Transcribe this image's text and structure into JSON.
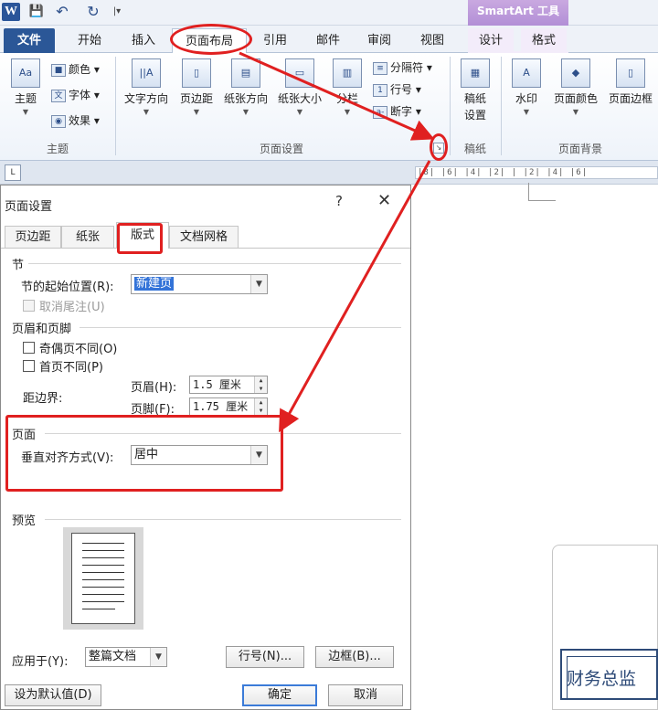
{
  "quick_access": {
    "app_logo": "W",
    "save_icon": "💾",
    "undo_icon": "↶",
    "redo_icon": "↻",
    "more_icon": "|▾"
  },
  "smartart_context_title": "SmartArt 工具",
  "ribbon_tabs": {
    "file": "文件",
    "home": "开始",
    "insert": "插入",
    "page_layout": "页面布局",
    "references": "引用",
    "mailings": "邮件",
    "review": "审阅",
    "view": "视图",
    "design": "设计",
    "format": "格式"
  },
  "ribbon": {
    "themes_group": {
      "label": "主题",
      "themes_btn": "主题",
      "colors_btn": "颜色",
      "fonts_btn": "字体",
      "effects_btn": "效果"
    },
    "page_setup_group": {
      "label": "页面设置",
      "text_direction": "文字方向",
      "margins": "页边距",
      "orientation": "纸张方向",
      "size": "纸张大小",
      "columns": "分栏",
      "breaks": "分隔符",
      "line_numbers": "行号",
      "hyphenation": "断字"
    },
    "draft_group": {
      "label": "稿纸",
      "draft_settings_line1": "稿纸",
      "draft_settings_line2": "设置"
    },
    "background_group": {
      "label": "页面背景",
      "watermark": "水印",
      "page_color": "页面颜色",
      "page_borders": "页面边框"
    },
    "launcher_icon": "↘"
  },
  "ruler": {
    "tab_selector": "L",
    "marks": "|8| |6| |4| |2| |  |2| |4| |6|"
  },
  "dialog": {
    "title": "页面设置",
    "help": "?",
    "close": "✕",
    "tabs": {
      "margins": "页边距",
      "paper": "纸张",
      "layout": "版式",
      "doc_grid": "文档网格"
    },
    "section": {
      "title": "节",
      "start_label": "节的起始位置(R):",
      "start_value": "新建页",
      "suppress_endnotes": "取消尾注(U)"
    },
    "headers_footers": {
      "title": "页眉和页脚",
      "odd_even": "奇偶页不同(O)",
      "first_page": "首页不同(P)",
      "from_edge_label": "距边界:",
      "header_label": "页眉(H):",
      "header_value": "1.5 厘米",
      "footer_label": "页脚(F):",
      "footer_value": "1.75 厘米"
    },
    "page": {
      "title": "页面",
      "vertical_align_label": "垂直对齐方式(V):",
      "vertical_align_value": "居中"
    },
    "preview": {
      "title": "预览",
      "apply_to_label": "应用于(Y):",
      "apply_to_value": "整篇文档",
      "line_numbers_btn": "行号(N)...",
      "borders_btn": "边框(B)..."
    },
    "set_default_btn": "设为默认值(D)",
    "ok_btn": "确定",
    "cancel_btn": "取消"
  },
  "document": {
    "smartart_text": "财务总监"
  },
  "colors": {
    "annotation": "#e02020",
    "file_tab": "#2b5797",
    "smartart_context": "#b28fd6",
    "selection": "#3373d8"
  }
}
